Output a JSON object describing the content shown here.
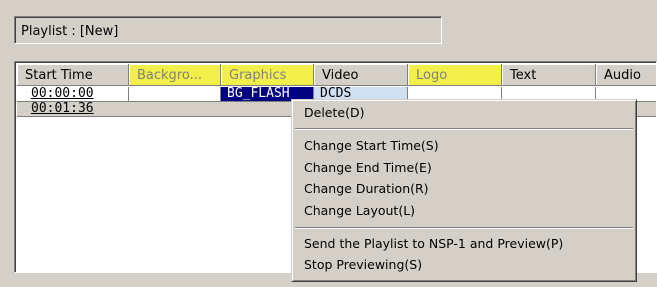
{
  "playlist_title": "Playlist : [New]",
  "columns": [
    "Start Time",
    "Backgro...",
    "Graphics",
    "Video",
    "Logo",
    "Text",
    "Audio"
  ],
  "rows": [
    {
      "start_time": "00:00:00",
      "graphics": "BG_FLASH",
      "video": "DCDS"
    },
    {
      "start_time": "00:01:36"
    }
  ],
  "context_menu": {
    "delete": "Delete(D)",
    "change_start_time": "Change Start Time(S)",
    "change_end_time": "Change End Time(E)",
    "change_duration": "Change Duration(R)",
    "change_layout": "Change Layout(L)",
    "send_preview": "Send the Playlist to NSP-1 and Preview(P)",
    "stop_previewing": "Stop Previewing(S)"
  },
  "colors": {
    "highlight_header": "#f2ee4a",
    "selection": "#000080",
    "face": "#d4d0c8"
  }
}
